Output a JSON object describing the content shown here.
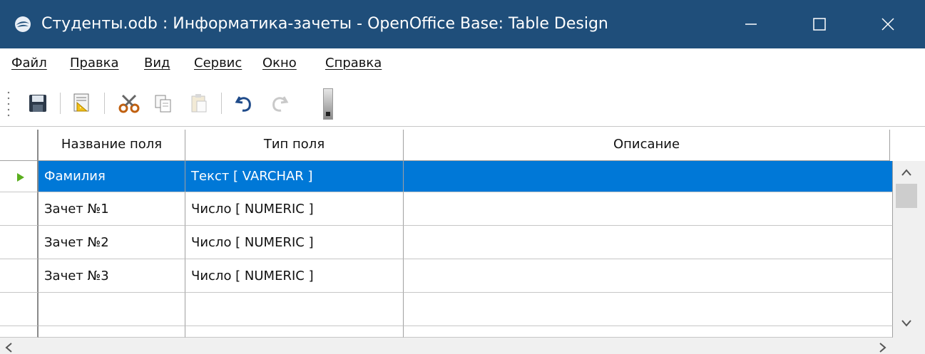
{
  "window": {
    "title": "Студенты.odb : Информатика-зачеты - OpenOffice Base: Table Design",
    "icon": "openoffice-icon",
    "title_bar_color": "#1f4e7a"
  },
  "menu": {
    "items": [
      {
        "label": "Файл"
      },
      {
        "label": "Правка"
      },
      {
        "label": "Вид"
      },
      {
        "label": "Сервис"
      },
      {
        "label": "Окно"
      },
      {
        "label": "Справка"
      }
    ]
  },
  "toolbar": {
    "buttons": [
      "save-icon",
      "index-design-icon",
      "cut-icon",
      "copy-icon",
      "paste-icon",
      "undo-icon",
      "redo-icon"
    ]
  },
  "table": {
    "headers": [
      "Название поля",
      "Тип поля",
      "Описание"
    ],
    "rows": [
      {
        "name": "Фамилия",
        "type": "Текст [ VARCHAR ]",
        "description": "",
        "selected": true
      },
      {
        "name": "Зачет №1",
        "type": "Число [ NUMERIC ]",
        "description": ""
      },
      {
        "name": "Зачет №2",
        "type": "Число [ NUMERIC ]",
        "description": ""
      },
      {
        "name": "Зачет №3",
        "type": "Число [ NUMERIC ]",
        "description": ""
      },
      {
        "name": "",
        "type": "",
        "description": ""
      },
      {
        "name": "",
        "type": "",
        "description": ""
      }
    ],
    "selection_color": "#0078d7"
  }
}
